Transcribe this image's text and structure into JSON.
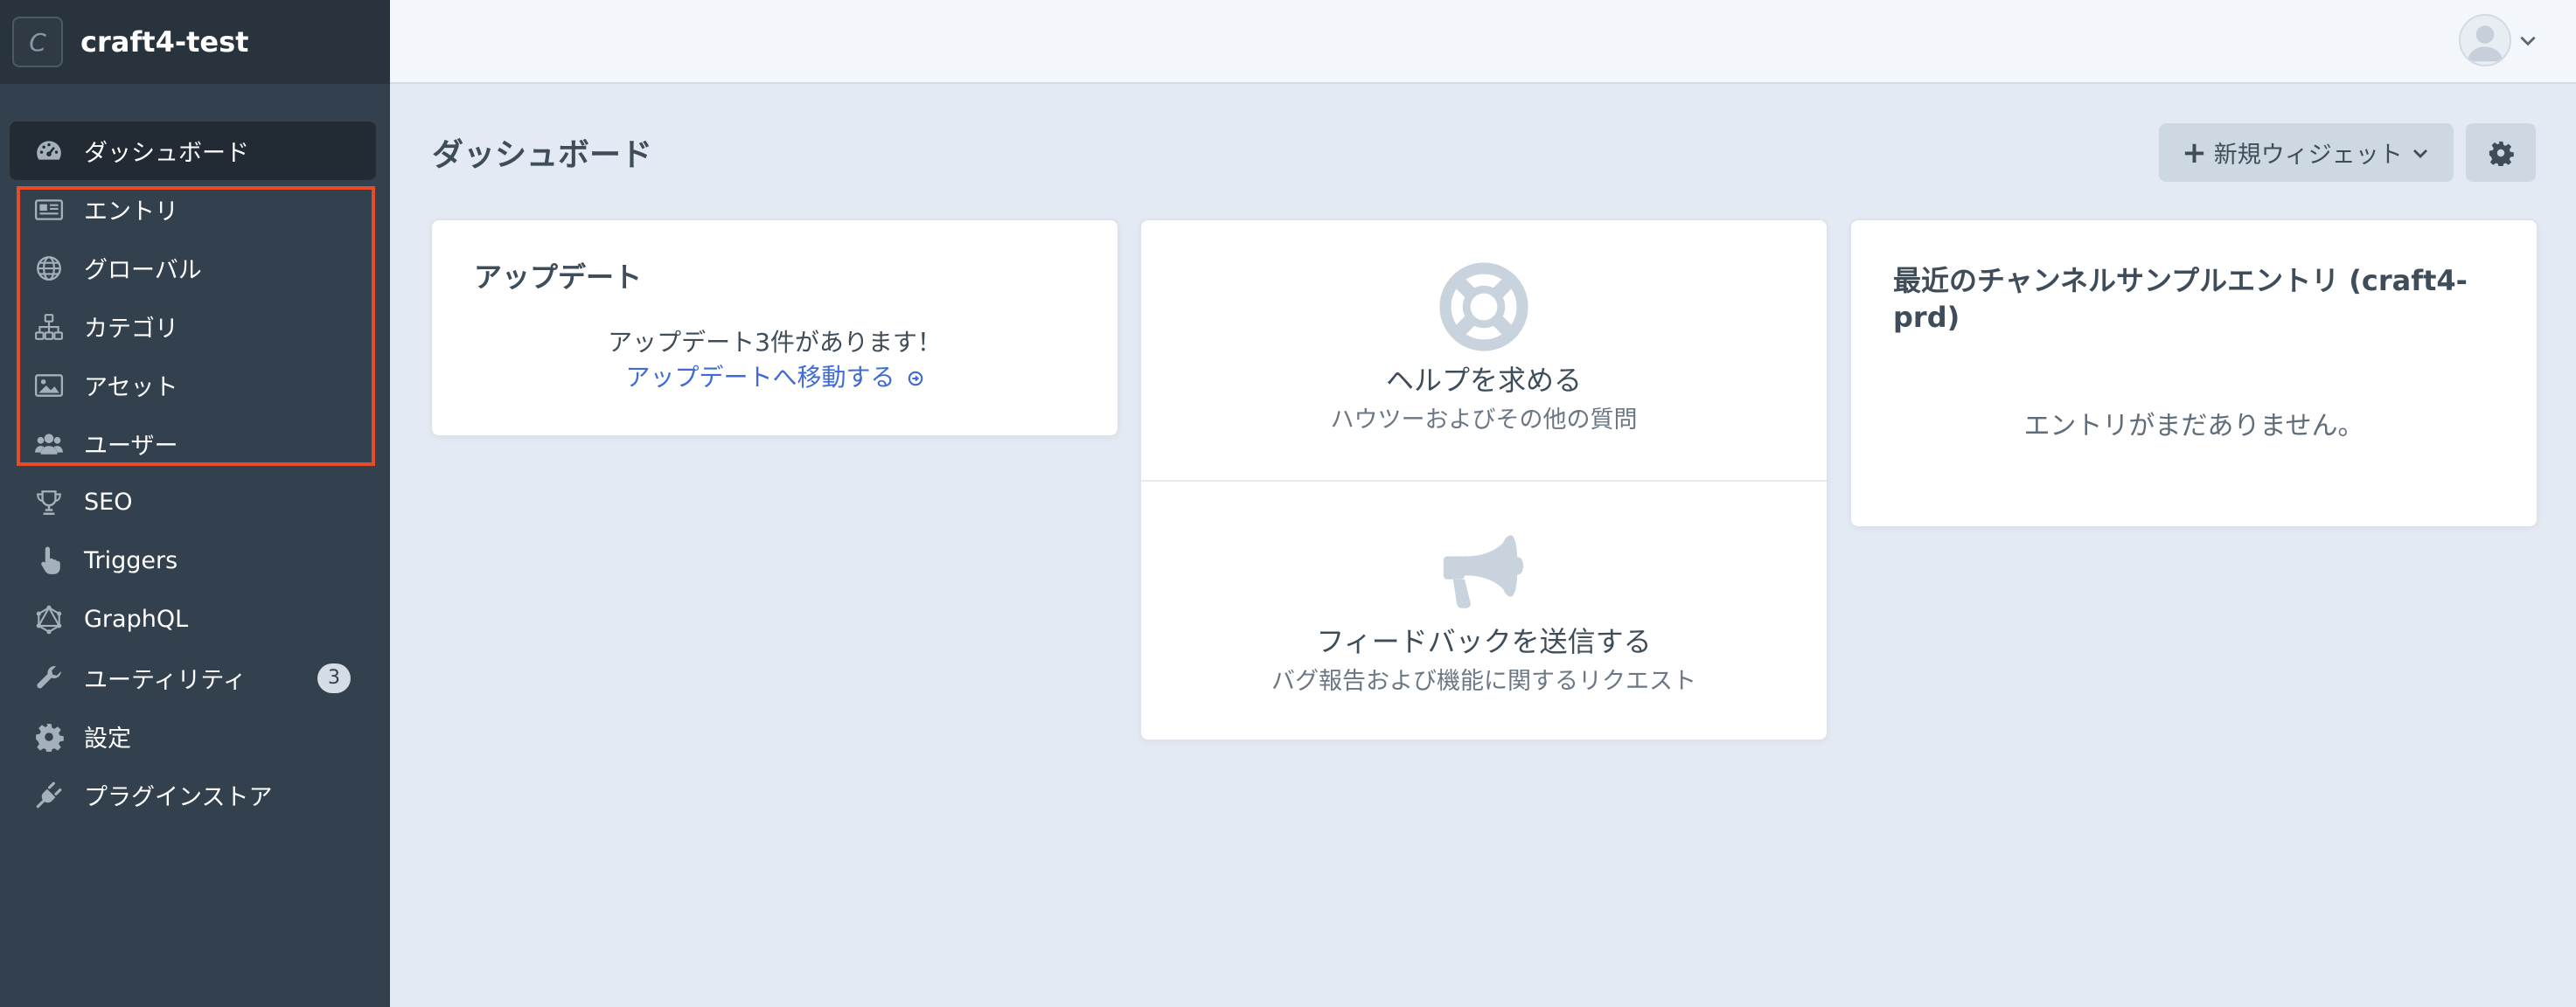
{
  "site": {
    "name": "craft4-test",
    "logo_letter": "C"
  },
  "nav": {
    "items": [
      {
        "label": "ダッシュボード",
        "icon": "dashboard-icon"
      },
      {
        "label": "エントリ",
        "icon": "newspaper-icon"
      },
      {
        "label": "グローバル",
        "icon": "globe-icon"
      },
      {
        "label": "カテゴリ",
        "icon": "sitemap-icon"
      },
      {
        "label": "アセット",
        "icon": "image-icon"
      },
      {
        "label": "ユーザー",
        "icon": "users-icon"
      },
      {
        "label": "SEO",
        "icon": "trophy-icon"
      },
      {
        "label": "Triggers",
        "icon": "pointer-hand-icon"
      },
      {
        "label": "GraphQL",
        "icon": "graphql-icon"
      },
      {
        "label": "ユーティリティ",
        "icon": "wrench-icon",
        "badge": "3"
      },
      {
        "label": "設定",
        "icon": "gear-icon"
      },
      {
        "label": "プラグインストア",
        "icon": "plug-icon"
      }
    ]
  },
  "header": {
    "account_icon": "user-avatar-icon"
  },
  "main": {
    "title": "ダッシュボード",
    "new_widget_label": "新規ウィジェット",
    "settings_icon": "gear-icon"
  },
  "widgets": {
    "updates": {
      "title": "アップデート",
      "message": "アップデート3件があります！",
      "link": "アップデートへ移動する"
    },
    "help": {
      "help_title": "ヘルプを求める",
      "help_sub": "ハウツーおよびその他の質問",
      "feedback_title": "フィードバックを送信する",
      "feedback_sub": "バグ報告および機能に関するリクエスト"
    },
    "recent": {
      "title": "最近のチャンネルサンプルエントリ (craft4-prd)",
      "empty": "エントリがまだありません。"
    }
  },
  "colors": {
    "sidebar": "#33404d",
    "highlight": "#e84b2c",
    "link": "#3e6bd6"
  }
}
